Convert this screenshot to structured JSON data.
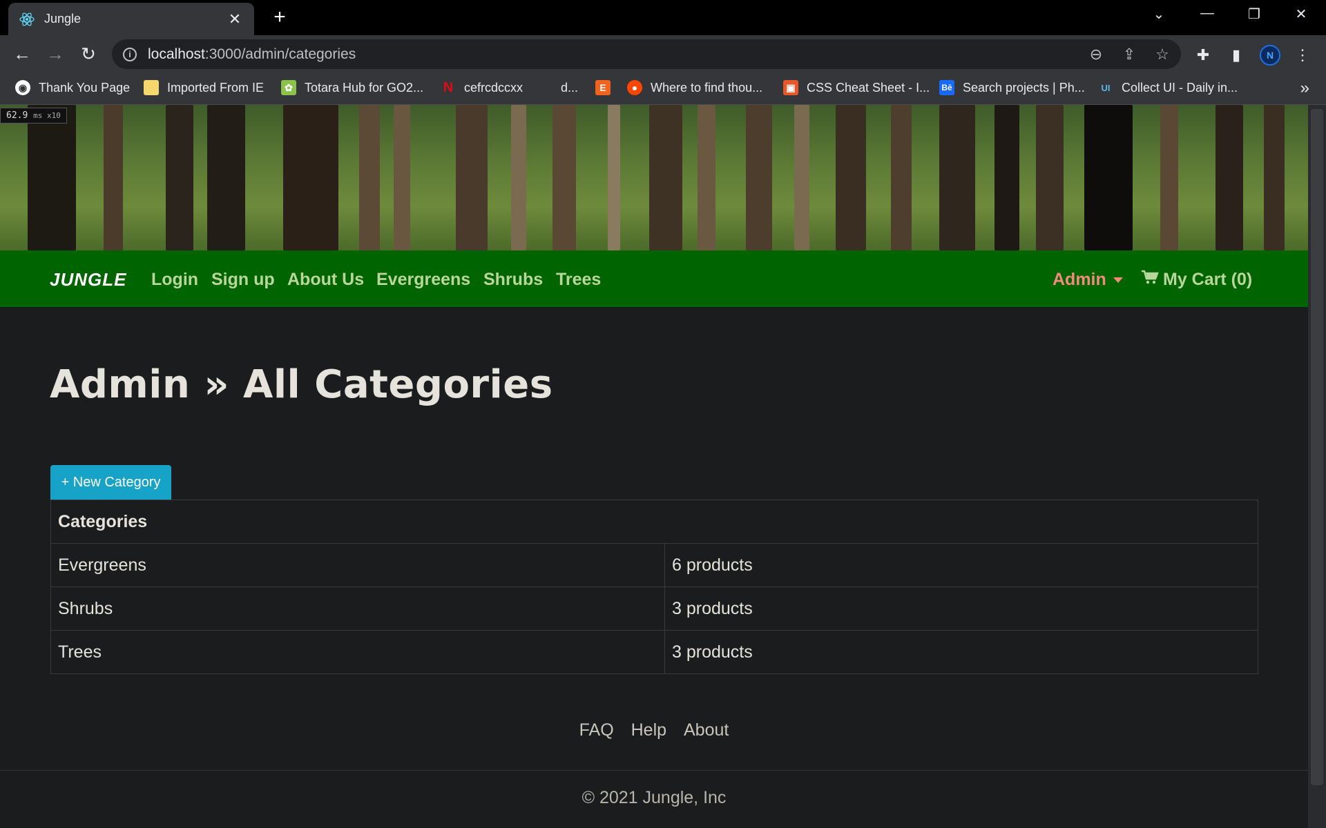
{
  "browser": {
    "tab_title": "Jungle",
    "url_host": "localhost",
    "url_path": ":3000/admin/categories",
    "bookmarks": [
      {
        "label": "Thank You Page",
        "icon": "globe-icon"
      },
      {
        "label": "Imported From IE",
        "icon": "folder-icon"
      },
      {
        "label": "Totara Hub for GO2...",
        "icon": "totara-icon"
      },
      {
        "label": "cefrcdccxx",
        "icon": "netflix-icon"
      },
      {
        "label": "d...",
        "icon": "blank-icon"
      },
      {
        "label": "",
        "icon": "etsy-icon"
      },
      {
        "label": "Where to find thou...",
        "icon": "reddit-icon"
      },
      {
        "label": "CSS Cheat Sheet - I...",
        "icon": "gift-icon"
      },
      {
        "label": "Search projects | Ph...",
        "icon": "behance-icon"
      },
      {
        "label": "Collect UI - Daily in...",
        "icon": "collectui-icon"
      }
    ],
    "profile_initial": "N"
  },
  "perf": {
    "value": "62.9",
    "unit": "ms x10"
  },
  "navbar": {
    "brand": "JUNGLE",
    "links": [
      "Login",
      "Sign up",
      "About Us",
      "Evergreens",
      "Shrubs",
      "Trees"
    ],
    "admin": "Admin",
    "cart": "My Cart (0)"
  },
  "page": {
    "title": "Admin » All Categories",
    "new_button": "+ New Category"
  },
  "table": {
    "header": "Categories",
    "rows": [
      {
        "name": "Evergreens",
        "count": "6 products"
      },
      {
        "name": "Shrubs",
        "count": "3 products"
      },
      {
        "name": "Trees",
        "count": "3 products"
      }
    ]
  },
  "footer": {
    "links": [
      "FAQ",
      "Help",
      "About"
    ],
    "copyright": "© 2021 Jungle, Inc"
  },
  "colors": {
    "navbar_bg": "#006400",
    "nav_link": "#b9d79c",
    "admin_link": "#f08b7e",
    "button_bg": "#17a2c8",
    "page_bg": "#1b1c1e"
  }
}
